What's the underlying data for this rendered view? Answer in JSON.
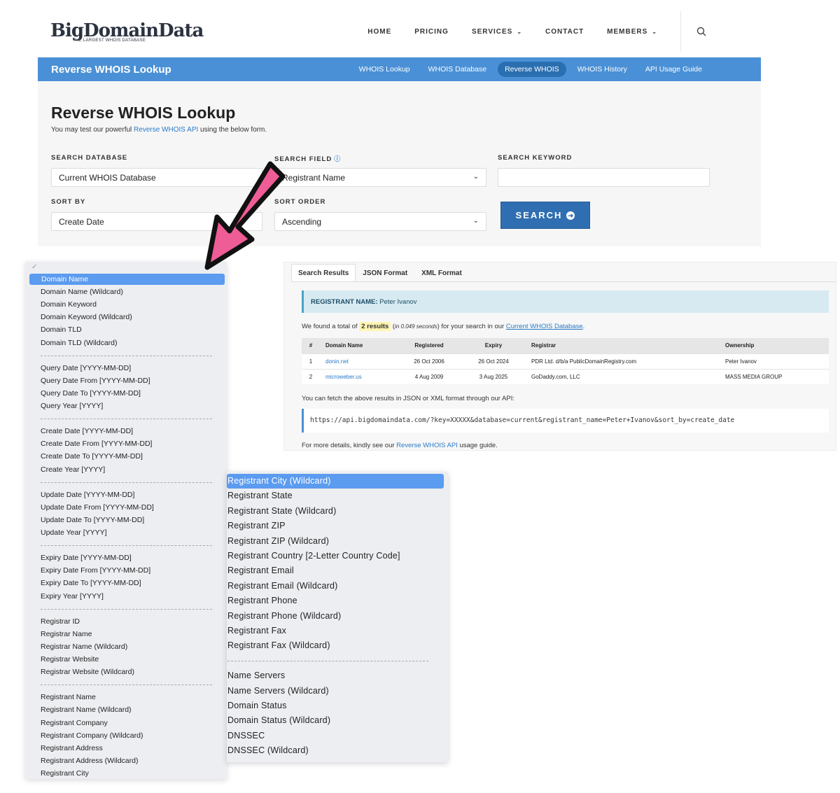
{
  "logo": {
    "main": "BigDomainData",
    "tagline": "THE LARGEST WHOIS DATABASE"
  },
  "menu": {
    "home": "HOME",
    "pricing": "PRICING",
    "services": "SERVICES",
    "contact": "CONTACT",
    "members": "MEMBERS"
  },
  "subbar": {
    "title": "Reverse WHOIS Lookup",
    "links": [
      "WHOIS Lookup",
      "WHOIS Database",
      "Reverse WHOIS",
      "WHOIS History",
      "API Usage Guide"
    ],
    "active": "Reverse WHOIS"
  },
  "form": {
    "title": "Reverse WHOIS Lookup",
    "subtitle_pre": "You may test our powerful ",
    "subtitle_link": "Reverse WHOIS API",
    "subtitle_post": " using the below form.",
    "search_database_label": "SEARCH DATABASE",
    "search_database_value": "Current WHOIS Database",
    "search_field_label": "SEARCH FIELD",
    "search_field_value": "Registrant Name",
    "search_keyword_label": "SEARCH KEYWORD",
    "search_keyword_value": "",
    "sort_by_label": "SORT BY",
    "sort_by_value": "Create Date",
    "sort_order_label": "SORT ORDER",
    "sort_order_value": "Ascending",
    "search_button": "SEARCH"
  },
  "dropdown_left": {
    "options": [
      "Domain Name",
      "Domain Name (Wildcard)",
      "Domain Keyword",
      "Domain Keyword (Wildcard)",
      "Domain TLD",
      "Domain TLD (Wildcard)",
      "Query Date [YYYY-MM-DD]",
      "Query Date From [YYYY-MM-DD]",
      "Query Date To [YYYY-MM-DD]",
      "Query Year [YYYY]",
      "Create Date [YYYY-MM-DD]",
      "Create Date From [YYYY-MM-DD]",
      "Create Date To [YYYY-MM-DD]",
      "Create Year [YYYY]",
      "Update Date [YYYY-MM-DD]",
      "Update Date From [YYYY-MM-DD]",
      "Update Date To [YYYY-MM-DD]",
      "Update Year [YYYY]",
      "Expiry Date [YYYY-MM-DD]",
      "Expiry Date From [YYYY-MM-DD]",
      "Expiry Date To [YYYY-MM-DD]",
      "Expiry Year [YYYY]",
      "Registrar ID",
      "Registrar Name",
      "Registrar Name (Wildcard)",
      "Registrar Website",
      "Registrar Website (Wildcard)",
      "Registrant Name",
      "Registrant Name (Wildcard)",
      "Registrant Company",
      "Registrant Company (Wildcard)",
      "Registrant Address",
      "Registrant Address (Wildcard)",
      "Registrant City"
    ],
    "selected": "Domain Name"
  },
  "dropdown_right": {
    "options": [
      "Registrant City (Wildcard)",
      "Registrant State",
      "Registrant State (Wildcard)",
      "Registrant ZIP",
      "Registrant ZIP (Wildcard)",
      "Registrant Country [2-Letter Country Code]",
      "Registrant Email",
      "Registrant Email (Wildcard)",
      "Registrant Phone",
      "Registrant Phone (Wildcard)",
      "Registrant Fax",
      "Registrant Fax (Wildcard)",
      "Name Servers",
      "Name Servers (Wildcard)",
      "Domain Status",
      "Domain Status (Wildcard)",
      "DNSSEC",
      "DNSSEC (Wildcard)"
    ],
    "selected": "Registrant City (Wildcard)"
  },
  "results": {
    "tabs": [
      "Search Results",
      "JSON Format",
      "XML Format"
    ],
    "active_tab": "Search Results",
    "registrant_label": "REGISTRANT NAME:",
    "registrant_value": "Peter Ivanov",
    "found_pre": "We found a total of ",
    "found_count": "2 results",
    "found_time": "in 0.049 seconds",
    "found_mid": " for your search in our ",
    "found_link": "Current WHOIS Database",
    "found_end": ".",
    "columns": [
      "#",
      "Domain Name",
      "Registered",
      "Expiry",
      "Registrar",
      "Ownership"
    ],
    "rows": [
      [
        "1",
        "donin.net",
        "26 Oct 2006",
        "26 Oct 2024",
        "PDR Ltd. d/b/a PublicDomainRegistry.com",
        "Peter Ivanov"
      ],
      [
        "2",
        "microweber.us",
        "4 Aug 2009",
        "3 Aug 2025",
        "GoDaddy.com, LLC",
        "MASS MEDIA GROUP"
      ]
    ],
    "api_note": "You can fetch the above results in JSON or XML format through our API:",
    "api_url": "https://api.bigdomaindata.com/?key=XXXXX&database=current&registrant_name=Peter+Ivanov&sort_by=create_date",
    "details_pre": "For more details, kindly see our ",
    "details_link": "Reverse WHOIS API",
    "details_post": " usage guide."
  },
  "colors": {
    "brand_blue": "#4a90d6",
    "active_blue": "#2a6fb0",
    "button_blue": "#2f6fb1",
    "arrow_pink": "#ef5d97",
    "selection_blue": "#5b9bf0"
  }
}
